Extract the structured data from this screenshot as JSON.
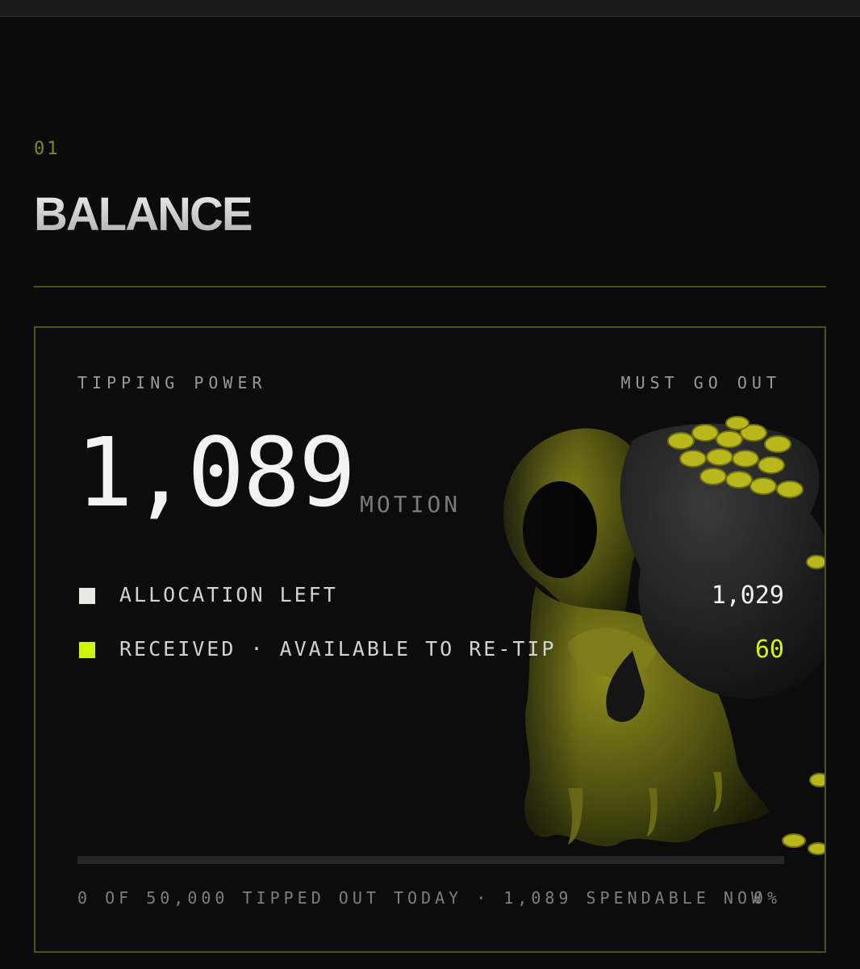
{
  "section": {
    "index": "01",
    "title": "BALANCE"
  },
  "card": {
    "label_left": "TIPPING POWER",
    "label_right": "MUST GO OUT",
    "balance": "1,089",
    "unit": "MOTION",
    "rows": [
      {
        "label": "ALLOCATION LEFT",
        "value": "1,029",
        "swatch_color": "#e9e9e2"
      },
      {
        "label": "RECEIVED · AVAILABLE TO RE-TIP",
        "value": "60",
        "swatch_color": "#cdf70a"
      }
    ],
    "progress": {
      "percent": 0,
      "footer_text": "0 OF 50,000 TIPPED OUT TODAY · 1,089 SPENDABLE NOW",
      "percent_label": "0%"
    },
    "illustration_icon": "hooded-figure-with-coin-sack-icon"
  },
  "colors": {
    "accent": "#cdf70a",
    "border": "#4d5413",
    "background": "#0b0b0b"
  }
}
